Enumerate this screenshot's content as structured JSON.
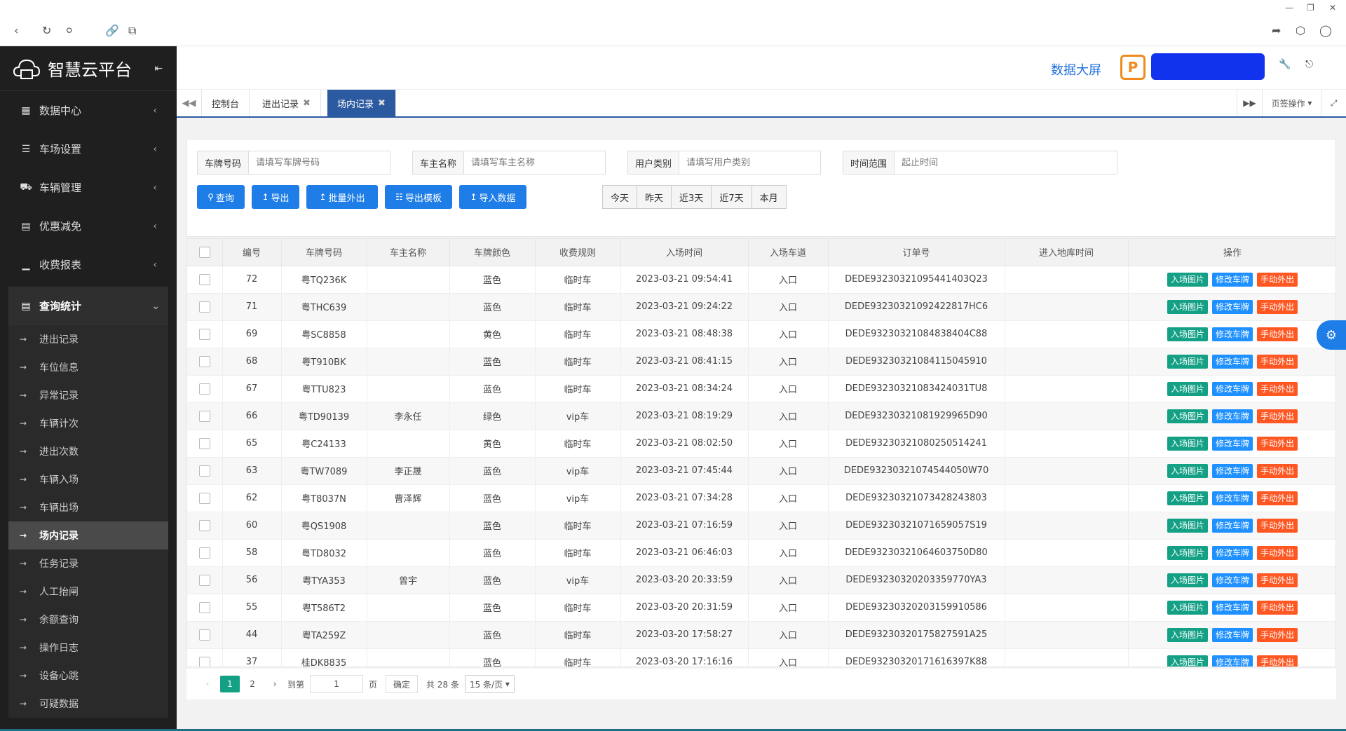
{
  "brand": {
    "title": "智慧云平台"
  },
  "topbar": {
    "big_screen": "数据大屏",
    "p_logo": "P"
  },
  "sidebar": {
    "items": [
      {
        "icon": "grid-icon",
        "label": "数据中心"
      },
      {
        "icon": "sliders-icon",
        "label": "车场设置"
      },
      {
        "icon": "car-icon",
        "label": "车辆管理"
      },
      {
        "icon": "card-icon",
        "label": "优惠减免"
      },
      {
        "icon": "bar-chart-icon",
        "label": "收费报表"
      }
    ],
    "open_item": {
      "icon": "table-icon",
      "label": "查询统计"
    },
    "sub_items": [
      "进出记录",
      "车位信息",
      "异常记录",
      "车辆计次",
      "进出次数",
      "车辆入场",
      "车辆出场",
      "场内记录",
      "任务记录",
      "人工抬闸",
      "余额查询",
      "操作日志",
      "设备心跳",
      "可疑数据"
    ],
    "active_sub": "场内记录"
  },
  "tabs": {
    "items": [
      {
        "label": "控制台",
        "closable": false
      },
      {
        "label": "进出记录",
        "closable": true
      },
      {
        "label": "场内记录",
        "closable": true,
        "active": true
      }
    ],
    "page_ops": "页签操作"
  },
  "search": {
    "fields": [
      {
        "label": "车牌号码",
        "placeholder": "请填写车牌号码"
      },
      {
        "label": "车主名称",
        "placeholder": "请填写车主名称"
      },
      {
        "label": "用户类别",
        "placeholder": "请填写用户类别"
      },
      {
        "label": "时间范围",
        "placeholder": "起止时间"
      }
    ],
    "buttons": [
      "查询",
      "导出",
      "批量外出",
      "导出模板",
      "导入数据"
    ],
    "quick_ranges": [
      "今天",
      "昨天",
      "近3天",
      "近7天",
      "本月"
    ]
  },
  "table": {
    "columns": [
      "编号",
      "车牌号码",
      "车主名称",
      "车牌颜色",
      "收费规则",
      "入场时间",
      "入场车道",
      "订单号",
      "进入地库时间",
      "操作"
    ],
    "actions": [
      "入场图片",
      "修改车牌",
      "手动外出"
    ],
    "rows": [
      [
        "72",
        "粤TQ236K",
        "",
        "蓝色",
        "临时车",
        "2023-03-21 09:54:41",
        "入口",
        "DEDE93230321095441403Q23",
        ""
      ],
      [
        "71",
        "粤THC639",
        "",
        "蓝色",
        "临时车",
        "2023-03-21 09:24:22",
        "入口",
        "DEDE93230321092422817HC6",
        ""
      ],
      [
        "69",
        "粤SC8858",
        "",
        "黄色",
        "临时车",
        "2023-03-21 08:48:38",
        "入口",
        "DEDE93230321084838404C88",
        ""
      ],
      [
        "68",
        "粤T910BK",
        "",
        "蓝色",
        "临时车",
        "2023-03-21 08:41:15",
        "入口",
        "DEDE93230321084115045910",
        ""
      ],
      [
        "67",
        "粤TTU823",
        "",
        "蓝色",
        "临时车",
        "2023-03-21 08:34:24",
        "入口",
        "DEDE93230321083424031TU8",
        ""
      ],
      [
        "66",
        "粤TD90139",
        "李永任",
        "绿色",
        "vip车",
        "2023-03-21 08:19:29",
        "入口",
        "DEDE93230321081929965D90",
        ""
      ],
      [
        "65",
        "粤C24133",
        "",
        "黄色",
        "临时车",
        "2023-03-21 08:02:50",
        "入口",
        "DEDE93230321080250514241",
        ""
      ],
      [
        "63",
        "粤TW7089",
        "李正晟",
        "蓝色",
        "vip车",
        "2023-03-21 07:45:44",
        "入口",
        "DEDE93230321074544050W70",
        ""
      ],
      [
        "62",
        "粤T8037N",
        "曹泽辉",
        "蓝色",
        "vip车",
        "2023-03-21 07:34:28",
        "入口",
        "DEDE93230321073428243803",
        ""
      ],
      [
        "60",
        "粤QS1908",
        "",
        "蓝色",
        "临时车",
        "2023-03-21 07:16:59",
        "入口",
        "DEDE93230321071659057S19",
        ""
      ],
      [
        "58",
        "粤TD8032",
        "",
        "蓝色",
        "临时车",
        "2023-03-21 06:46:03",
        "入口",
        "DEDE93230321064603750D80",
        ""
      ],
      [
        "56",
        "粤TYA353",
        "曾宇",
        "蓝色",
        "vip车",
        "2023-03-20 20:33:59",
        "入口",
        "DEDE93230320203359770YA3",
        ""
      ],
      [
        "55",
        "粤T586T2",
        "",
        "蓝色",
        "临时车",
        "2023-03-20 20:31:59",
        "入口",
        "DEDE93230320203159910586",
        ""
      ],
      [
        "44",
        "粤TA259Z",
        "",
        "蓝色",
        "临时车",
        "2023-03-20 17:58:27",
        "入口",
        "DEDE93230320175827591A25",
        ""
      ],
      [
        "37",
        "桂DK8835",
        "",
        "蓝色",
        "临时车",
        "2023-03-20 17:16:16",
        "入口",
        "DEDE93230320171616397K88",
        ""
      ]
    ]
  },
  "pager": {
    "pages": [
      "1",
      "2"
    ],
    "current": "1",
    "goto_label": "到第",
    "goto_value": "1",
    "page_unit": "页",
    "confirm": "确定",
    "total": "共 28 条",
    "page_size": "15 条/页"
  },
  "colors": {
    "accent": "#1e7de6",
    "tab_active": "#2c5aa0",
    "green_btn": "#14a085",
    "orange_btn": "#ff5722",
    "sidebar_bg": "#1f1f1f"
  }
}
